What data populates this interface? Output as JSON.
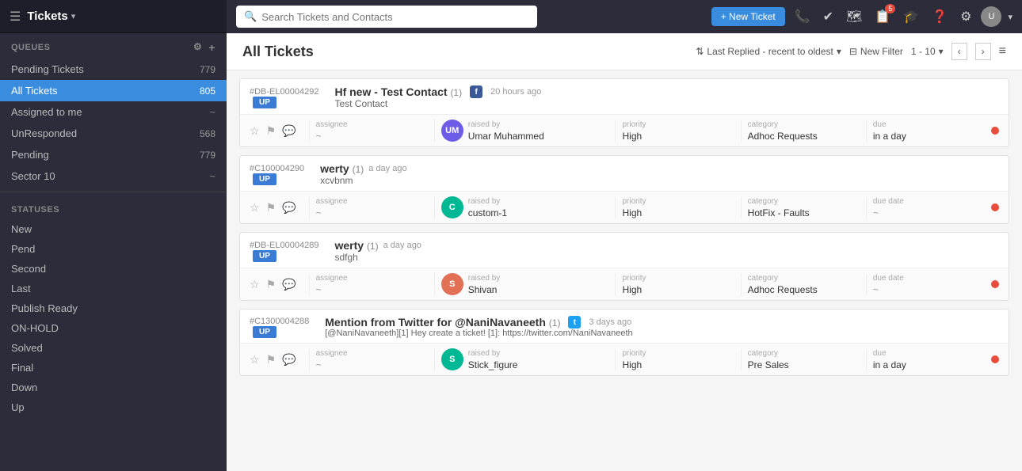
{
  "app": {
    "title": "Tickets",
    "search_placeholder": "Search Tickets and Contacts"
  },
  "topbar": {
    "new_ticket_label": "+ New Ticket",
    "notification_badge": "5"
  },
  "sidebar": {
    "queues_label": "QUEUES",
    "statuses_label": "STATUSES",
    "items": [
      {
        "label": "Pending Tickets",
        "count": "779",
        "active": false
      },
      {
        "label": "All Tickets",
        "count": "805",
        "active": true
      },
      {
        "label": "Assigned to me",
        "count": "~",
        "active": false
      },
      {
        "label": "UnResponded",
        "count": "568",
        "active": false
      },
      {
        "label": "Pending",
        "count": "779",
        "active": false
      },
      {
        "label": "Sector 10",
        "count": "~",
        "active": false
      }
    ],
    "statuses": [
      "New",
      "Pend",
      "Second",
      "Last",
      "Publish Ready",
      "ON-HOLD",
      "Solved",
      "Final",
      "Down",
      "Up"
    ]
  },
  "content": {
    "page_title": "All Tickets",
    "sort_label": "Last Replied - recent to oldest",
    "filter_label": "New Filter",
    "pagination": "1 - 10"
  },
  "tickets": [
    {
      "id": "#DB-EL00004292",
      "badge": "UP",
      "title": "Hf new - Test Contact",
      "count": "(1)",
      "source": "facebook",
      "time": "20 hours ago",
      "subtitle": "Test Contact",
      "assignee_label": "assignee",
      "assignee_value": "~",
      "raised_label": "raised by",
      "raised_name": "Umar Muhammed",
      "raised_avatar_color": "#6c5ce7",
      "raised_avatar_initials": "UM",
      "priority_label": "priority",
      "priority_value": "High",
      "category_label": "category",
      "category_value": "Adhoc Requests",
      "due_label": "due",
      "due_value": "in a day"
    },
    {
      "id": "#C100004290",
      "badge": "UP",
      "title": "werty",
      "count": "(1)",
      "source": "",
      "time": "a day ago",
      "subtitle": "xcvbnm",
      "assignee_label": "assignee",
      "assignee_value": "~",
      "raised_label": "raised by",
      "raised_name": "custom-1",
      "raised_avatar_color": "#00b894",
      "raised_avatar_initials": "C",
      "priority_label": "priority",
      "priority_value": "High",
      "category_label": "category",
      "category_value": "HotFix - Faults",
      "due_label": "due date",
      "due_value": "~"
    },
    {
      "id": "#DB-EL00004289",
      "badge": "UP",
      "title": "werty",
      "count": "(1)",
      "source": "",
      "time": "a day ago",
      "subtitle": "sdfgh",
      "assignee_label": "assignee",
      "assignee_value": "~",
      "raised_label": "raised by",
      "raised_name": "Shivan",
      "raised_avatar_color": "#e17055",
      "raised_avatar_initials": "S",
      "priority_label": "priority",
      "priority_value": "High",
      "category_label": "category",
      "category_value": "Adhoc Requests",
      "due_label": "due date",
      "due_value": "~"
    },
    {
      "id": "#C1300004288",
      "badge": "UP",
      "title": "Mention from Twitter for @NaniNavaneeth",
      "count": "(1)",
      "source": "twitter",
      "time": "3 days ago",
      "subtitle": "[@NaniNavaneeth][1] Hey create a ticket! [1]: https://twitter.com/NaniNavaneeth",
      "assignee_label": "assignee",
      "assignee_value": "~",
      "raised_label": "raised by",
      "raised_name": "Stick_figure",
      "raised_avatar_color": "#00b894",
      "raised_avatar_initials": "S",
      "priority_label": "priority",
      "priority_value": "High",
      "category_label": "category",
      "category_value": "Pre Sales",
      "due_label": "due",
      "due_value": "in a day"
    }
  ]
}
